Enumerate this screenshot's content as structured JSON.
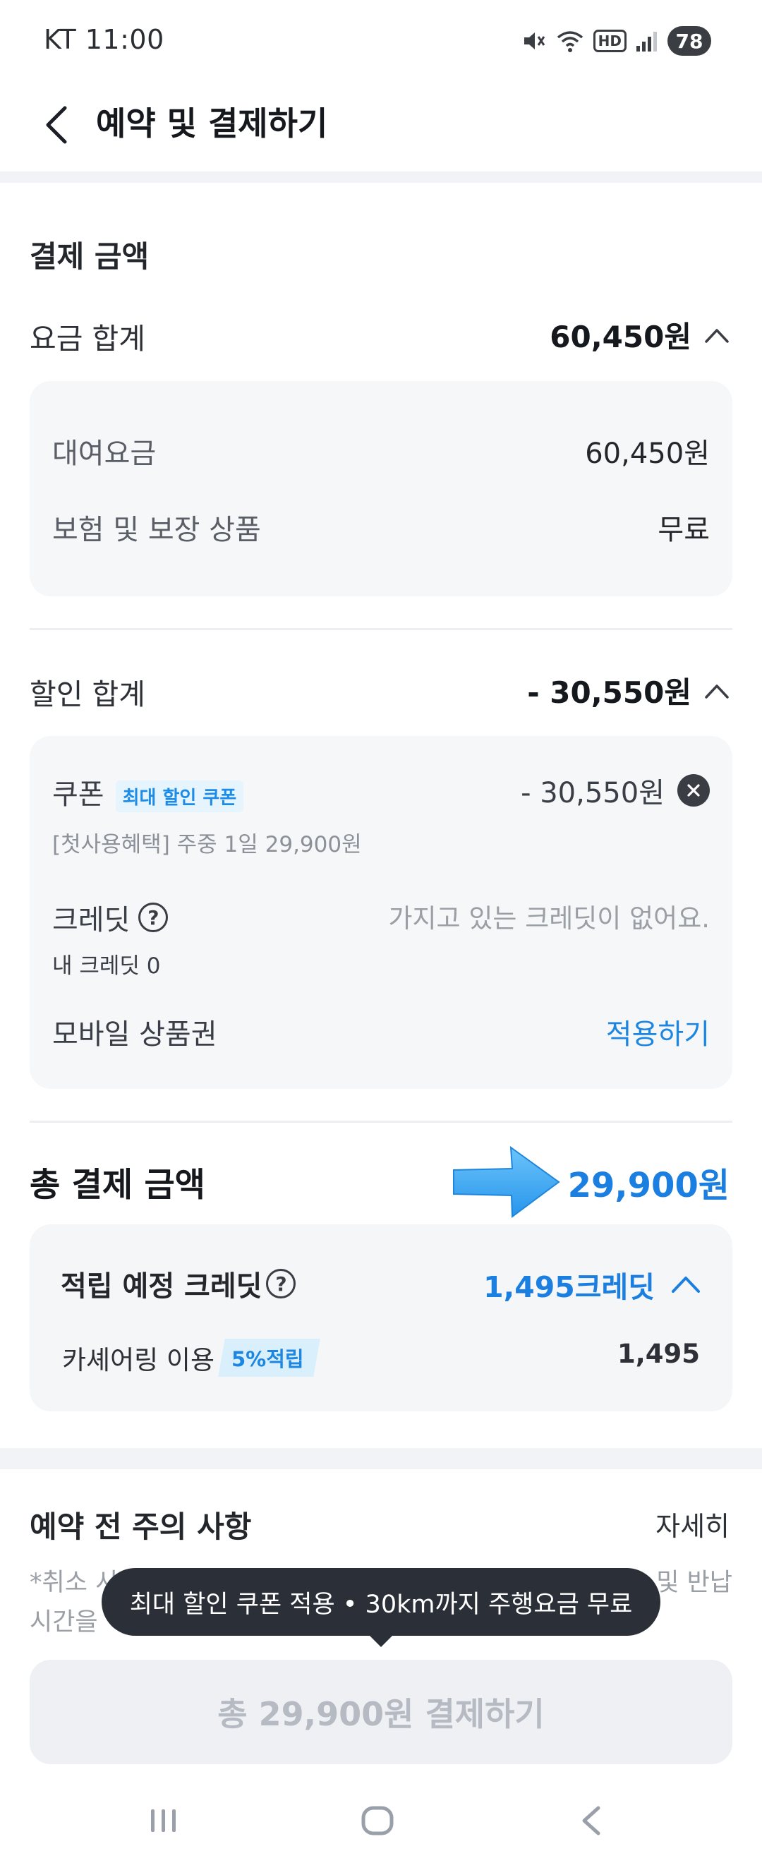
{
  "status_bar": {
    "carrier_time": "KT 11:00",
    "battery": "78",
    "hd_label": "HD"
  },
  "header": {
    "title": "예약 및 결제하기"
  },
  "payment": {
    "section_title": "결제 금액",
    "fare_total_label": "요금 합계",
    "fare_total_value": "60,450원",
    "fare_items": [
      {
        "label": "대여요금",
        "value": "60,450원"
      },
      {
        "label": "보험 및 보장 상품",
        "value": "무료"
      }
    ],
    "discount_total_label": "할인 합계",
    "discount_total_value": "- 30,550원",
    "coupon": {
      "label": "쿠폰",
      "badge": "최대 할인 쿠폰",
      "value": "- 30,550원",
      "note": "[첫사용혜택] 주중 1일 29,900원"
    },
    "credit": {
      "label": "크레딧",
      "help": "?",
      "status": "가지고 있는 크레딧이 없어요.",
      "mine": "내 크레딧 0"
    },
    "gift_card": {
      "label": "모바일 상품권",
      "action": "적용하기"
    },
    "grand_total_label": "총 결제 금액",
    "grand_total_value": "29,900원"
  },
  "earn": {
    "title": "적립 예정 크레딧",
    "help": "?",
    "value": "1,495크레딧",
    "row_label": "카셰어링 이용",
    "row_badge": "5%적립",
    "row_value": "1,495"
  },
  "notice": {
    "title": "예약 전 주의 사항",
    "more": "자세히",
    "text_start": "*취소 시",
    "text_end": "및 반납",
    "text_line2": "시간을"
  },
  "tooltip": {
    "text": "최대 할인 쿠폰 적용 • 30km까지 주행요금 무료"
  },
  "pay_button": {
    "label": "총 29,900원 결제하기"
  },
  "colors": {
    "accent_blue": "#1a7fe0",
    "arrow_blue": "#3aa8f4",
    "dark": "#15181d"
  }
}
